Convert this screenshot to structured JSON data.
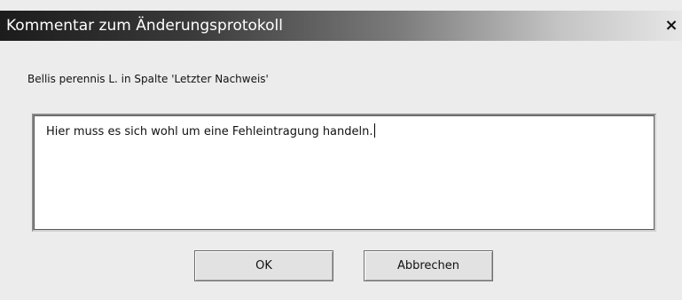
{
  "dialog": {
    "title": "Kommentar zum Änderungsprotokoll",
    "close_label": "×",
    "context_label": "Bellis perennis L. in Spalte 'Letzter Nachweis'",
    "comment_value": "Hier muss es sich wohl um eine Fehleintragung handeln.",
    "ok_label": "OK",
    "cancel_label": "Abbrechen"
  }
}
